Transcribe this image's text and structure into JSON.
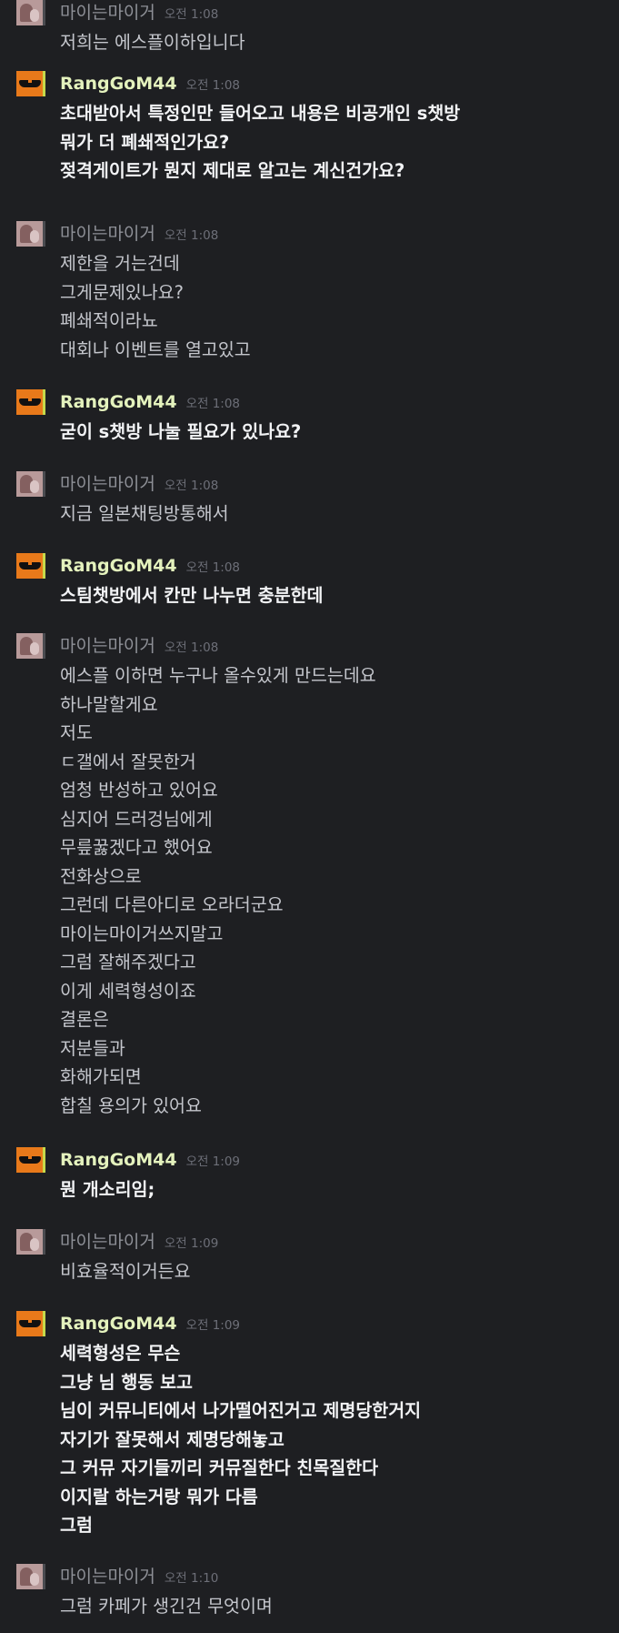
{
  "messages": [
    {
      "user": "마이는마이거",
      "time": "오전 1:08",
      "lines": [
        "저희는 에스플이하입니다"
      ]
    },
    {
      "user": "RangGoM44",
      "time": "오전 1:08",
      "lines": [
        "초대받아서 특정인만 들어오고 내용은 비공개인 s챗방",
        "뭐가 더 폐쇄적인가요?",
        "젖격게이트가 뭔지 제대로 알고는 계신건가요?"
      ]
    },
    {
      "user": "마이는마이거",
      "time": "오전 1:08",
      "lines": [
        "제한을 거는건데",
        "그게문제있나요?",
        "폐쇄적이라뇨",
        "대회나 이벤트를 열고있고"
      ]
    },
    {
      "user": "RangGoM44",
      "time": "오전 1:08",
      "lines": [
        "굳이 s챗방 나눌 필요가 있나요?"
      ]
    },
    {
      "user": "마이는마이거",
      "time": "오전 1:08",
      "lines": [
        "지금 일본채팅방통해서"
      ]
    },
    {
      "user": "RangGoM44",
      "time": "오전 1:08",
      "lines": [
        "스팀챗방에서 칸만 나누면 충분한데"
      ]
    },
    {
      "user": "마이는마이거",
      "time": "오전 1:08",
      "lines": [
        "에스플 이하면 누구나 올수있게 만드는데요",
        "하나말할게요",
        "저도",
        "ㄷ갤에서 잘못한거",
        "엄청 반성하고 있어요",
        "심지어 드러겅님에게",
        "무릎꿇겠다고 했어요",
        "전화상으로",
        "그런데 다른아디로 오라더군요",
        "마이는마이거쓰지말고",
        "그럼 잘해주겠다고",
        "이게 세력형성이죠",
        "결론은",
        "저분들과",
        "화해가되면",
        "합칠 용의가 있어요"
      ]
    },
    {
      "user": "RangGoM44",
      "time": "오전 1:09",
      "lines": [
        "뭔 개소리임;"
      ]
    },
    {
      "user": "마이는마이거",
      "time": "오전 1:09",
      "lines": [
        "비효율적이거든요"
      ]
    },
    {
      "user": "RangGoM44",
      "time": "오전 1:09",
      "lines": [
        "세력형성은 무슨",
        "그냥 님 행동 보고",
        "님이 커뮤니티에서 나가떨어진거고 제명당한거지",
        "자기가 잘못해서 제명당해놓고",
        "그 커뮤 자기들끼리 커뮤질한다 친목질한다",
        "이지랄 하는거랑 뭐가 다름",
        "그럼"
      ]
    },
    {
      "user": "마이는마이거",
      "time": "오전 1:10",
      "lines": [
        "그럼 카페가 생긴건 무엇이며"
      ]
    }
  ],
  "icons": {
    "RangGoM44": "sunglasses-avatar-icon",
    "마이는마이거": "profile-photo-avatar-icon"
  },
  "colors": {
    "background": "#1e1f22",
    "name_RangGoM44": "#e4f2bd",
    "name_other": "#8e9097",
    "text_RangGoM44": "#f2f3f5",
    "text_other": "#c4c6cc",
    "timestamp": "#6d6f78",
    "avatar_orange": "#e8791a",
    "avatar_bar": "#c6d94a"
  }
}
